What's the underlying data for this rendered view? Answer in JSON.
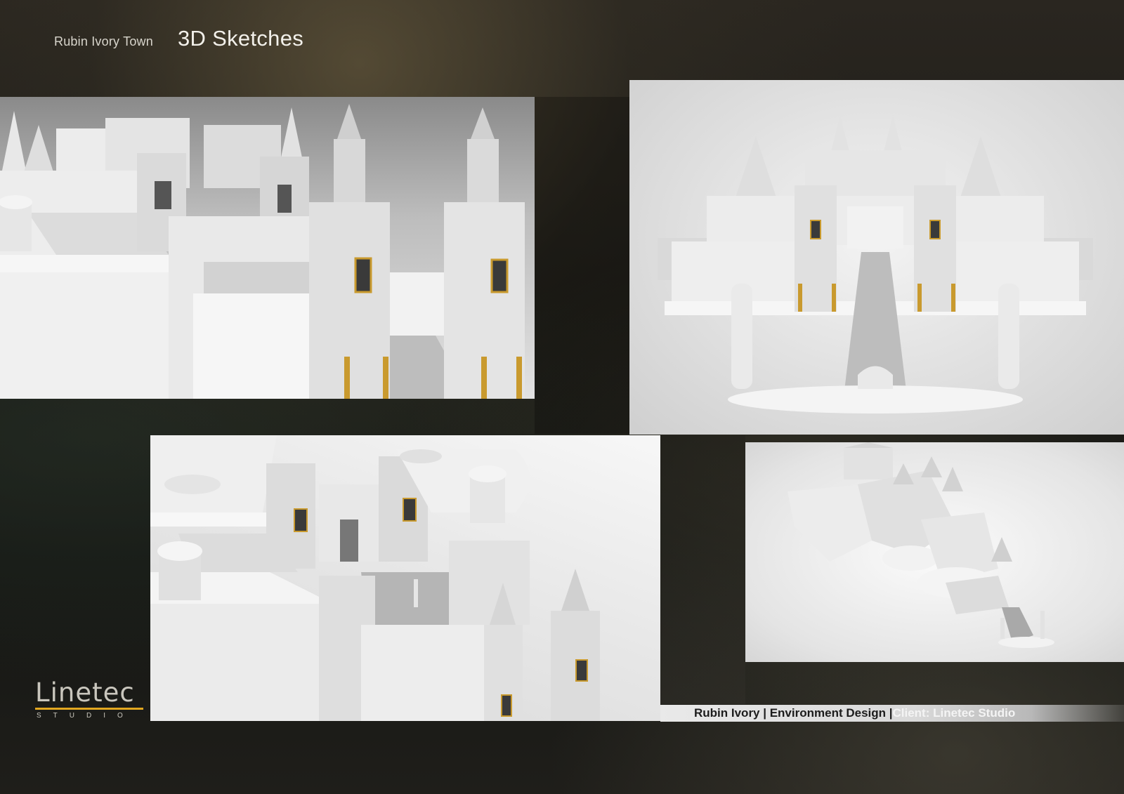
{
  "header": {
    "subtitle": "Rubin Ivory Town",
    "title": "3D Sketches"
  },
  "panels": [
    {
      "name": "render-closeup-towers"
    },
    {
      "name": "render-front-elevation"
    },
    {
      "name": "render-aerial-courtyard"
    },
    {
      "name": "render-full-overview"
    }
  ],
  "caption": {
    "part1": "Rubin Ivory | Environment Design | ",
    "part2": "Client: Linetec Studio"
  },
  "logo": {
    "word": "Linetec",
    "sub": "STUDIO",
    "accent_color": "#e2a71f"
  },
  "colors": {
    "gold_trim": "#c99a2e",
    "render_white": "#f1f1f1"
  }
}
